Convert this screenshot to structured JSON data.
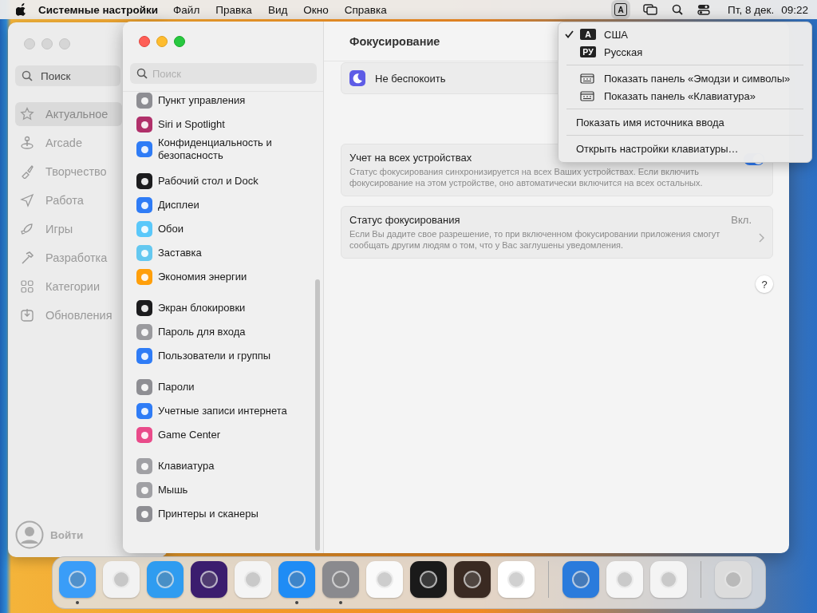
{
  "menu_bar": {
    "app_name": "Системные настройки",
    "menus": [
      "Файл",
      "Правка",
      "Вид",
      "Окно",
      "Справка"
    ],
    "input_source": {
      "label": "A",
      "open": true
    },
    "date": "Пт, 8 дек.",
    "time": "09:22"
  },
  "background_window": {
    "search": {
      "placeholder": "Поиск"
    },
    "items": [
      {
        "label": "Актуальное",
        "selected": true
      },
      {
        "label": "Arcade",
        "selected": false
      },
      {
        "label": "Творчество",
        "selected": false
      },
      {
        "label": "Работа",
        "selected": false
      },
      {
        "label": "Игры",
        "selected": false
      },
      {
        "label": "Разработка",
        "selected": false
      },
      {
        "label": "Категории",
        "selected": false
      },
      {
        "label": "Обновления",
        "selected": false
      }
    ],
    "account": "Войти"
  },
  "settings_window": {
    "search": {
      "placeholder": "Поиск"
    },
    "sidebar": {
      "groups": [
        [
          {
            "label": "Пункт управления",
            "color": "#8e8e93"
          },
          {
            "label": "Siri и Spotlight",
            "color": "#b0306a"
          },
          {
            "label": "Конфиденциальность и безопасность",
            "color": "#2f7cf6"
          }
        ],
        [
          {
            "label": "Рабочий стол и Dock",
            "color": "#1c1c1e"
          },
          {
            "label": "Дисплеи",
            "color": "#2f7cf6"
          },
          {
            "label": "Обои",
            "color": "#5ac8fa"
          },
          {
            "label": "Заставка",
            "color": "#64c8f0"
          },
          {
            "label": "Экономия энергии",
            "color": "#ff9f0a"
          }
        ],
        [
          {
            "label": "Экран блокировки",
            "color": "#1c1c1e"
          },
          {
            "label": "Пароль для входа",
            "color": "#9a9a9e"
          },
          {
            "label": "Пользователи и группы",
            "color": "#2f7cf6"
          }
        ],
        [
          {
            "label": "Пароли",
            "color": "#8e8e93"
          },
          {
            "label": "Учетные записи интернета",
            "color": "#2f7cf6"
          },
          {
            "label": "Game Center",
            "color": "#e94b8a"
          }
        ],
        [
          {
            "label": "Клавиатура",
            "color": "#a0a0a4"
          },
          {
            "label": "Мышь",
            "color": "#a0a0a4"
          },
          {
            "label": "Принтеры и сканеры",
            "color": "#8e8e93"
          }
        ]
      ]
    },
    "title": "Фокусирование",
    "focus_modes": [
      {
        "label": "Не беспокоить",
        "color": "#5e5ce6"
      }
    ],
    "options": [
      {
        "kind": "toggle",
        "title": "Учет на всех устройствах",
        "description": "Статус фокусирования синхронизируется на всех Ваших устройствах. Если включить фокусирование на этом устройстве, оно автоматически включится на всех остальных.",
        "on": true
      },
      {
        "kind": "link",
        "title": "Статус фокусирования",
        "description": "Если Вы дадите свое разрешение, то при включенном фокусировании приложения смогут сообщать другим людям о том, что у Вас заглушены уведомления.",
        "value": "Вкл."
      }
    ],
    "help": "?"
  },
  "input_menu": {
    "items": [
      {
        "kind": "source",
        "badge": "A",
        "label": "США",
        "checked": true
      },
      {
        "kind": "source",
        "badge": "РУ",
        "label": "Русская",
        "checked": false
      },
      {
        "kind": "separator"
      },
      {
        "kind": "panel",
        "label": "Показать панель «Эмодзи и символы»"
      },
      {
        "kind": "panel",
        "label": "Показать панель «Клавиатура»"
      },
      {
        "kind": "separator"
      },
      {
        "kind": "action",
        "label": "Показать имя источника ввода"
      },
      {
        "kind": "separator"
      },
      {
        "kind": "action",
        "label": "Открыть настройки клавиатуры…"
      }
    ]
  },
  "dock": {
    "sections": [
      [
        {
          "color": "#3a9df8",
          "running": true
        },
        {
          "color": "#f2f2f2",
          "running": false
        },
        {
          "color": "#2f9cf0",
          "running": false
        },
        {
          "color": "#3b1d6e",
          "running": false
        },
        {
          "color": "#f4f4f4",
          "running": false
        },
        {
          "color": "#1f8cf5",
          "running": true
        },
        {
          "color": "#8a8a8e",
          "running": true
        },
        {
          "color": "#fafafa",
          "running": false
        },
        {
          "color": "#1a1a1a",
          "running": false
        },
        {
          "color": "#3a2a22",
          "running": false
        },
        {
          "color": "#ffffff",
          "running": false
        }
      ],
      [
        {
          "color": "#2a7bdc",
          "running": false
        },
        {
          "color": "#f6f6f6",
          "running": false
        },
        {
          "color": "#f4f4f4",
          "running": false
        }
      ],
      [
        {
          "color": "#dcdcdc",
          "running": false
        }
      ]
    ]
  }
}
